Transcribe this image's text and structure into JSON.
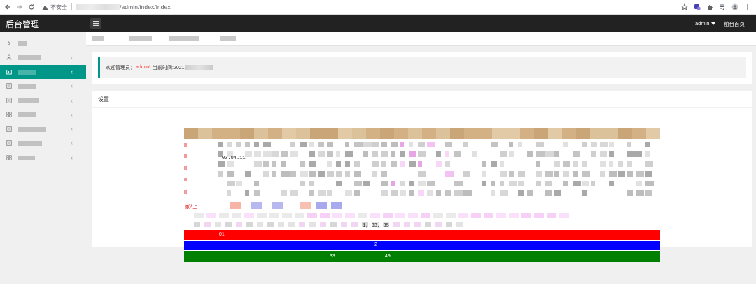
{
  "browser": {
    "security_label": "不安全",
    "url_path": "/admin/index/index"
  },
  "app": {
    "title": "后台管理",
    "user_menu": "admin",
    "front_link": "前台首页"
  },
  "sidebar": {
    "items": [
      {
        "icon": "chevron-right-icon",
        "active": false
      },
      {
        "icon": "user-icon",
        "active": false
      },
      {
        "icon": "folder-icon",
        "active": true
      },
      {
        "icon": "document-icon",
        "active": false
      },
      {
        "icon": "document-icon",
        "active": false
      },
      {
        "icon": "grid-icon",
        "active": false
      },
      {
        "icon": "document-icon",
        "active": false
      },
      {
        "icon": "document-icon",
        "active": false
      },
      {
        "icon": "grid-icon",
        "active": false
      }
    ]
  },
  "welcome": {
    "prefix": "欢迎管理员：",
    "admin_name": "admin!",
    "time_label": "当前时间:2021"
  },
  "settings": {
    "title": "设置",
    "visible_values": {
      "date_fragment": "03.04.11",
      "row_label": "家/上",
      "numbers_row": "1, 33, 35",
      "n1": "01",
      "n2": "49",
      "n3": "33",
      "n4": "2"
    }
  },
  "colors": {
    "accent": "#009688",
    "topbar": "#222222",
    "header_band": "#d9b88e",
    "red_band": "#ff0000",
    "blue_band": "#0000ff",
    "green_band": "#008000"
  }
}
